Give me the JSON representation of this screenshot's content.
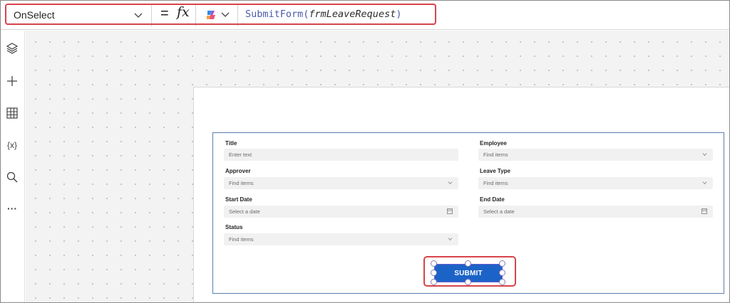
{
  "formula_bar": {
    "property": "OnSelect",
    "equals": "=",
    "fx": "fx",
    "formula_func": "SubmitForm(",
    "formula_arg": "frmLeaveRequest",
    "formula_close": ")"
  },
  "left_rail": {
    "icons": [
      "layers-icon",
      "plus-icon",
      "table-icon",
      "variables-icon",
      "search-icon",
      "more-icon"
    ],
    "variables_label": "{x}",
    "more_label": "···"
  },
  "form": {
    "fields": [
      {
        "label": "Title",
        "placeholder": "Enter text",
        "kind": "text"
      },
      {
        "label": "Employee",
        "placeholder": "Find items",
        "kind": "combo"
      },
      {
        "label": "Approver",
        "placeholder": "Find items",
        "kind": "combo"
      },
      {
        "label": "Leave Type",
        "placeholder": "Find items",
        "kind": "combo"
      },
      {
        "label": "Start Date",
        "placeholder": "Select a date",
        "kind": "date"
      },
      {
        "label": "End Date",
        "placeholder": "Select a date",
        "kind": "date"
      },
      {
        "label": "Status",
        "placeholder": "Find items",
        "kind": "combo"
      }
    ]
  },
  "submit": {
    "label": "SUBMIT"
  },
  "colors": {
    "highlight": "#d8434a",
    "button": "#1c63c7",
    "form_border": "#5a7fb0",
    "formula_text": "#4b5aa8"
  }
}
